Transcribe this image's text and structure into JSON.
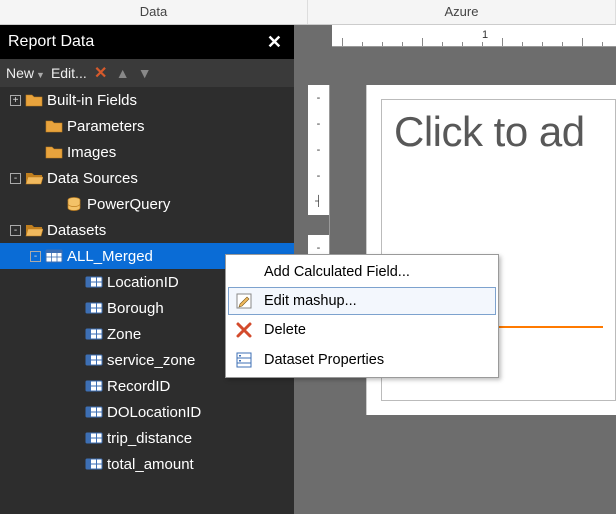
{
  "top_tabs": {
    "left": "Data",
    "right": "Azure"
  },
  "panel": {
    "title": "Report Data",
    "toolbar": {
      "new": "New",
      "edit": "Edit..."
    }
  },
  "tree": [
    {
      "id": "builtinfields",
      "label": "Built-in Fields",
      "depth": 0,
      "exp": "+",
      "icon": "folder",
      "sel": false
    },
    {
      "id": "parameters",
      "label": "Parameters",
      "depth": 1,
      "exp": "",
      "icon": "folder",
      "sel": false
    },
    {
      "id": "images",
      "label": "Images",
      "depth": 1,
      "exp": "",
      "icon": "folder",
      "sel": false
    },
    {
      "id": "datasources",
      "label": "Data Sources",
      "depth": 0,
      "exp": "-",
      "icon": "folder-open",
      "sel": false
    },
    {
      "id": "powerquery",
      "label": "PowerQuery",
      "depth": 2,
      "exp": "",
      "icon": "datasource",
      "sel": false
    },
    {
      "id": "datasets",
      "label": "Datasets",
      "depth": 0,
      "exp": "-",
      "icon": "folder-open",
      "sel": false
    },
    {
      "id": "allmerged",
      "label": "ALL_Merged",
      "depth": 1,
      "exp": "-",
      "icon": "dataset",
      "sel": true
    },
    {
      "id": "locationid",
      "label": "LocationID",
      "depth": 3,
      "exp": "",
      "icon": "field",
      "sel": false
    },
    {
      "id": "borough",
      "label": "Borough",
      "depth": 3,
      "exp": "",
      "icon": "field",
      "sel": false
    },
    {
      "id": "zone",
      "label": "Zone",
      "depth": 3,
      "exp": "",
      "icon": "field",
      "sel": false
    },
    {
      "id": "servicezone",
      "label": "service_zone",
      "depth": 3,
      "exp": "",
      "icon": "field",
      "sel": false
    },
    {
      "id": "recordid",
      "label": "RecordID",
      "depth": 3,
      "exp": "",
      "icon": "field",
      "sel": false
    },
    {
      "id": "dolocationid",
      "label": "DOLocationID",
      "depth": 3,
      "exp": "",
      "icon": "field",
      "sel": false
    },
    {
      "id": "tripdistance",
      "label": "trip_distance",
      "depth": 3,
      "exp": "",
      "icon": "field",
      "sel": false
    },
    {
      "id": "totalamount",
      "label": "total_amount",
      "depth": 3,
      "exp": "",
      "icon": "field",
      "sel": false
    }
  ],
  "ctxmenu": [
    {
      "id": "addcalc",
      "label": "Add Calculated Field...",
      "icon": "",
      "hov": false
    },
    {
      "id": "editmashup",
      "label": "Edit mashup...",
      "icon": "edit",
      "hov": true
    },
    {
      "id": "delete",
      "label": "Delete",
      "icon": "delete",
      "hov": false
    },
    {
      "id": "dsprops",
      "label": "Dataset Properties",
      "icon": "props",
      "hov": false
    }
  ],
  "surface": {
    "ruler_mark": "1",
    "placeholder": "Click to ad"
  }
}
